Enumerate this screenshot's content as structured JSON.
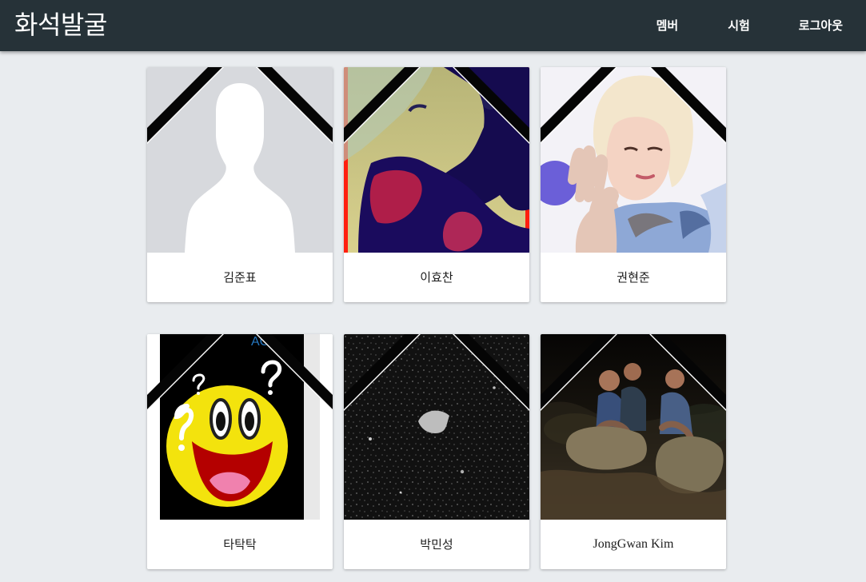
{
  "app": {
    "title": "화석발굴"
  },
  "nav": {
    "members": "멤버",
    "exam": "시험",
    "logout": "로그아웃"
  },
  "members": [
    {
      "name": "김준표",
      "photo": "default-profile-silhouette"
    },
    {
      "name": "이효찬",
      "photo": "blurry-selfie-photo"
    },
    {
      "name": "권현준",
      "photo": "waving-blonde-woman-photo"
    },
    {
      "name": "타탁탁",
      "photo": "confused-smiley-phone-photo"
    },
    {
      "name": "박민성",
      "photo": "dark-asphalt-photo"
    },
    {
      "name": "JongGwan Kim",
      "photo": "three-people-on-rocks-photo"
    }
  ],
  "decoration": {
    "ribbon": "black-mourning-ribbon"
  }
}
